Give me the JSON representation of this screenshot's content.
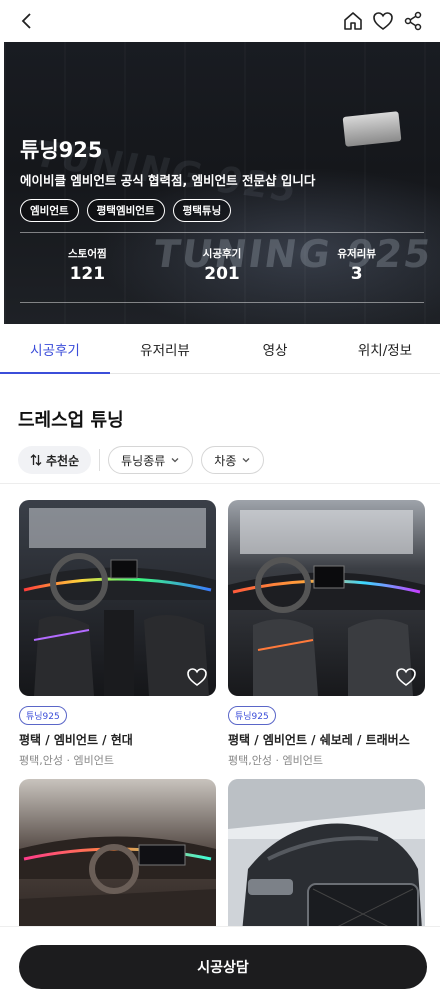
{
  "header": {
    "back_icon": "chevron-left-icon",
    "home_icon": "home-icon",
    "favorite_icon": "heart-icon",
    "share_icon": "share-icon"
  },
  "hero": {
    "store_name": "튜닝925",
    "tagline": "에이비클 엠비언트 공식 협력점, 엠비언트 전문샵 입니다",
    "tags": [
      "엠비언트",
      "평택엠비언트",
      "평택튜닝"
    ],
    "watermark": "TUNING 925",
    "stats": [
      {
        "label": "스토어찜",
        "value": "121"
      },
      {
        "label": "시공후기",
        "value": "201"
      },
      {
        "label": "유저리뷰",
        "value": "3"
      }
    ]
  },
  "tabs": [
    {
      "label": "시공후기",
      "active": true
    },
    {
      "label": "유저리뷰",
      "active": false
    },
    {
      "label": "영상",
      "active": false
    },
    {
      "label": "위치/정보",
      "active": false
    }
  ],
  "section": {
    "title": "드레스업 튜닝",
    "sort_label": "추천순",
    "filter_1": "튜닝종류",
    "filter_2": "차종"
  },
  "cards": [
    {
      "badge": "튜닝925",
      "title": "평택 / 엠비언트 / 현대",
      "sub": "평택,안성 · 엠비언트"
    },
    {
      "badge": "튜닝925",
      "title": "평택 / 엠비언트 / 쉐보레 / 트래버스",
      "sub": "평택,안성 · 엠비언트"
    }
  ],
  "cta_label": "시공상담",
  "colors": {
    "accent": "#3b4dd9",
    "cta": "#1c1c1e"
  }
}
